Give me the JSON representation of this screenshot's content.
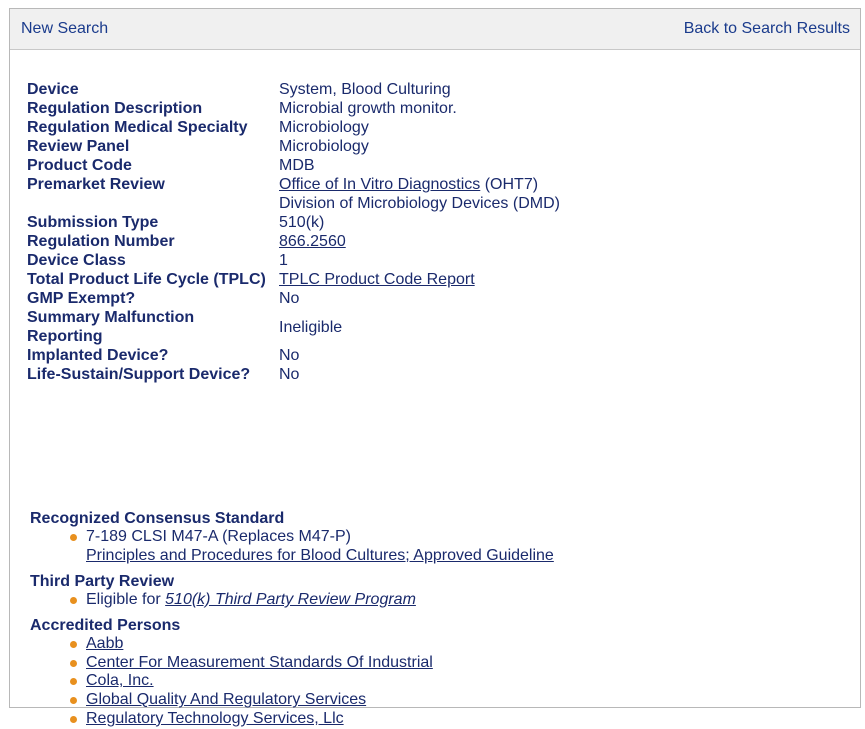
{
  "topbar": {
    "new_search": "New Search",
    "back_to_results": "Back to Search Results"
  },
  "details": {
    "device": {
      "label": "Device",
      "value": "System, Blood Culturing"
    },
    "regulation_description": {
      "label": "Regulation Description",
      "value": "Microbial growth monitor."
    },
    "regulation_medical_specialty": {
      "label": "Regulation Medical Specialty",
      "value": "Microbiology"
    },
    "review_panel": {
      "label": "Review Panel",
      "value": "Microbiology"
    },
    "product_code": {
      "label": "Product Code",
      "value": "MDB"
    },
    "premarket_review": {
      "label": "Premarket Review",
      "office_link": "Office of In Vitro Diagnostics",
      "office_code": " (OHT7)",
      "division": "Division of Microbiology Devices (DMD)"
    },
    "submission_type": {
      "label": "Submission Type",
      "value": "510(k)"
    },
    "regulation_number": {
      "label": "Regulation Number",
      "value": "866.2560"
    },
    "device_class": {
      "label": "Device Class",
      "value": "1"
    },
    "tplc": {
      "label": "Total Product Life Cycle (TPLC)",
      "value": "TPLC Product Code Report"
    },
    "gmp_exempt": {
      "label": "GMP Exempt?",
      "value": "No"
    },
    "summary_malfunction": {
      "label_line1": "Summary Malfunction",
      "label_line2": "Reporting",
      "value": "Ineligible"
    },
    "implanted_device": {
      "label": "Implanted Device?",
      "value": "No"
    },
    "life_sustain": {
      "label": "Life-Sustain/Support Device?",
      "value": "No"
    }
  },
  "consensus": {
    "title": "Recognized Consensus Standard",
    "item_line1": "7-189 CLSI M47-A (Replaces M47-P)",
    "item_link": "Principles and Procedures for Blood Cultures; Approved Guideline"
  },
  "third_party": {
    "title": "Third Party Review",
    "prefix": "Eligible for ",
    "link": "510(k) Third Party Review Program"
  },
  "accredited": {
    "title": "Accredited Persons",
    "items": [
      "Aabb",
      "Center For Measurement Standards Of Industrial",
      "Cola, Inc.",
      "Global Quality And Regulatory Services",
      "Regulatory Technology Services, Llc"
    ]
  },
  "colors": {
    "text": "#1a2a6c",
    "bullet": "#e8901e",
    "topbar_bg": "#f0f0f0"
  }
}
